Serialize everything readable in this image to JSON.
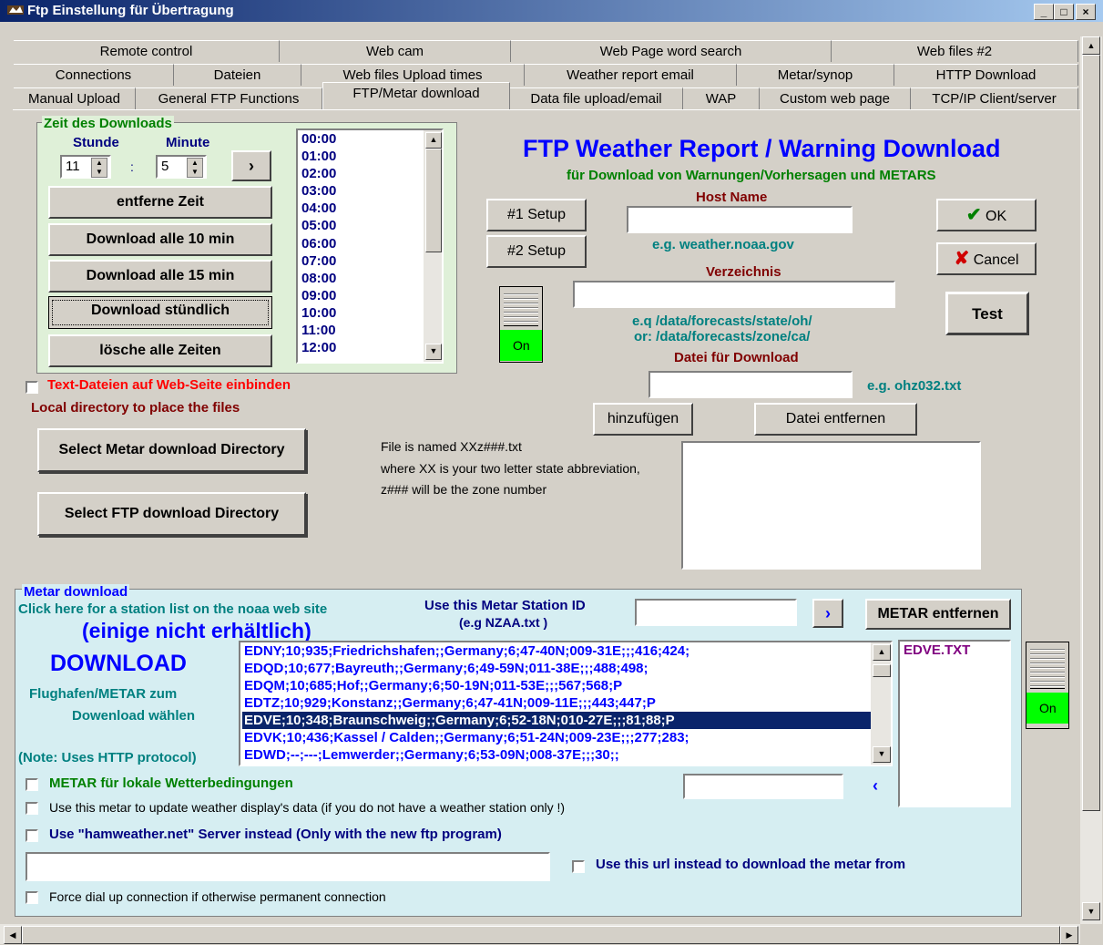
{
  "window": {
    "title": "Ftp Einstellung für Übertragung",
    "min": "_",
    "max": "□",
    "close": "×"
  },
  "tabs": {
    "row1": [
      "Remote control",
      "Web cam",
      "Web Page word search",
      "Web files #2"
    ],
    "row2": [
      "Connections",
      "Dateien",
      "Web files Upload times",
      "Weather report email",
      "Metar/synop",
      "HTTP Download"
    ],
    "row3": [
      "Manual Upload",
      "General FTP Functions",
      "FTP/Metar download",
      "Data file upload/email",
      "WAP",
      "Custom web page",
      "TCP/IP Client/server"
    ]
  },
  "download_time": {
    "group_label": "Zeit des Downloads",
    "hour_label": "Stunde",
    "minute_label": "Minute",
    "hour_value": "11",
    "minute_value": "5",
    "separator": ":",
    "add_button": "›",
    "remove_button": "entferne Zeit",
    "every10_button": "Download alle 10 min",
    "every15_button": "Download alle 15 min",
    "hourly_button": "Download stündlich",
    "clear_button": "lösche alle Zeiten",
    "times": [
      "00:00",
      "01:00",
      "02:00",
      "03:00",
      "04:00",
      "05:00",
      "06:00",
      "07:00",
      "08:00",
      "09:00",
      "10:00",
      "11:00",
      "12:00"
    ]
  },
  "textfiles_checkbox": "Text-Dateien auf Web-Seite einbinden",
  "local_dir_label": "Local directory to place the files",
  "select_metar_dir_button": "Select Metar download Directory",
  "select_ftp_dir_button": "Select FTP download  Directory",
  "ftp": {
    "heading": "FTP Weather Report / Warning Download",
    "subheading": "für Download von Warnungen/Vorhersagen und METARS",
    "setup1": "#1 Setup",
    "setup2": "#2 Setup",
    "host_label": "Host Name",
    "host_example": "e.g. weather.noaa.gov",
    "dir_label": "Verzeichnis",
    "dir_example1": "e.q /data/forecasts/state/oh/",
    "dir_example2": "or: /data/forecasts/zone/ca/",
    "file_label": "Datei für Download",
    "file_example": "e.g. ohz032.txt",
    "add_button": "hinzufügen",
    "remove_button": "Datei entfernen",
    "ok_button": "OK",
    "cancel_button": "Cancel",
    "test_button": "Test",
    "toggle_label": "On",
    "note1": "File is named XXz###.txt",
    "note2": "where XX is your two letter state abbreviation,",
    "note3": "z### will be the zone number"
  },
  "metar": {
    "group_label": "Metar download",
    "station_list_link": "Click here for a station list on the noaa web site",
    "not_available": "(einige nicht erhältlich)",
    "download_label": "DOWNLOAD",
    "choose_label1": "Flughafen/METAR zum",
    "choose_label2": "Dowenload wählen",
    "note_label": "(Note: Uses HTTP protocol)",
    "station_id_label1": "Use this Metar Station ID",
    "station_id_label2": "(e.g NZAA.txt )",
    "add_button": "›",
    "remove_button": "METAR entfernen",
    "stations": [
      "EDNY;10;935;Friedrichshafen;;Germany;6;47-40N;009-31E;;;416;424;",
      "EDQD;10;677;Bayreuth;;Germany;6;49-59N;011-38E;;;488;498;",
      "EDQM;10;685;Hof;;Germany;6;50-19N;011-53E;;;567;568;P",
      "EDTZ;10;929;Konstanz;;Germany;6;47-41N;009-11E;;;443;447;P",
      "EDVE;10;348;Braunschweig;;Germany;6;52-18N;010-27E;;;81;88;P",
      "EDVK;10;436;Kassel / Calden;;Germany;6;51-24N;009-23E;;;277;283;",
      "EDWD;--;---;Lemwerder;;Germany;6;53-09N;008-37E;;;30;;"
    ],
    "selected_files": [
      "EDVE.TXT"
    ],
    "local_weather_checkbox": "METAR für lokale Wetterbedingungen",
    "update_display_checkbox": "Use this metar to update weather display's data (if you do not have a weather station only !)",
    "hamweather_checkbox": "Use \"hamweather.net\" Server instead (Only with the new ftp program)",
    "url_checkbox": "Use this url instead to download the metar from",
    "dialup_checkbox": "Force dial up connection if otherwise permanent connection",
    "back_arrow": "‹",
    "toggle_label": "On"
  },
  "colors": {
    "title_blue": "#0a246a",
    "heading_blue": "#0000ff",
    "green_text": "#008000",
    "dark_red": "#800000",
    "teal": "#008080",
    "green_panel": "#dff0d8",
    "blue_panel": "#d6eef2",
    "selected_row": "#0a246a",
    "toggle_green": "#00ff00"
  }
}
